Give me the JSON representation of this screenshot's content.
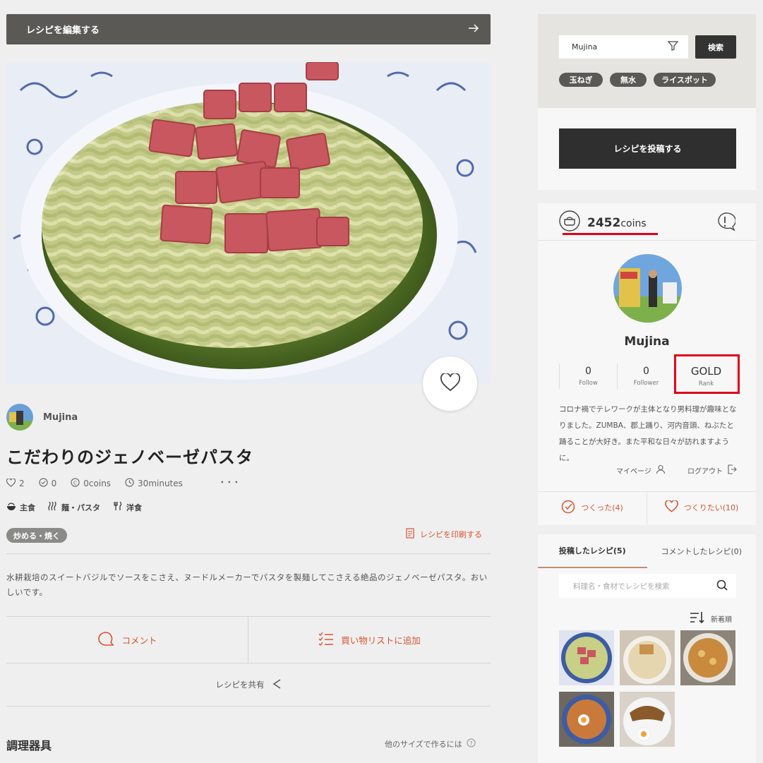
{
  "edit_bar": {
    "label": "レシピを編集する"
  },
  "author": {
    "name": "Mujina"
  },
  "recipe": {
    "title": "こだわりのジェノベーゼパスタ",
    "likes": "2",
    "made": "0",
    "coins": "0coins",
    "time": "30minutes",
    "more": "･･･",
    "categories": [
      "主食",
      "麺・パスタ",
      "洋食"
    ],
    "tag": "炒める・焼く",
    "print_label": "レシピを印刷する",
    "description": "水耕栽培のスイートバジルでソースをこさえ、ヌードルメーカーでパスタを製麺してこさえる絶品のジェノベーゼパスタ。おいしいです。",
    "comment_label": "コメント",
    "shopping_label": "買い物リストに追加",
    "share_label": "レシピを共有",
    "tools_title": "調理器具",
    "other_size_label": "他のサイズで作るには"
  },
  "search": {
    "value": "Mujina",
    "button_label": "検索",
    "chips": [
      "玉ねぎ",
      "無水",
      "ライスポット"
    ]
  },
  "post_button": {
    "label": "レシピを投稿する"
  },
  "profile": {
    "coins_value": "2452",
    "coins_unit": "coins",
    "name": "Mujina",
    "follow_count": "0",
    "follow_label": "Follow",
    "follower_count": "0",
    "follower_label": "Follower",
    "rank_value": "GOLD",
    "rank_label": "Rank",
    "bio": "コロナ禍でテレワークが主体となり男料理が趣味となりました。ZUMBA、郡上踊り、河内音頭、ねぶたと踊ることが大好き。また平和な日々が訪れますように。",
    "mypage_label": "マイページ",
    "logout_label": "ログアウト",
    "made_label": "つくった(4)",
    "want_label": "つくりたい(10)"
  },
  "recipes_panel": {
    "tab_posted": "投稿したレシピ(5)",
    "tab_commented": "コメントしたレシピ(0)",
    "search_placeholder": "料理名・食材でレシピを検索",
    "sort_label": "新着順"
  },
  "colors": {
    "accent": "#d9532f",
    "highlight": "#e0001b",
    "dark": "#2f2f2f"
  }
}
